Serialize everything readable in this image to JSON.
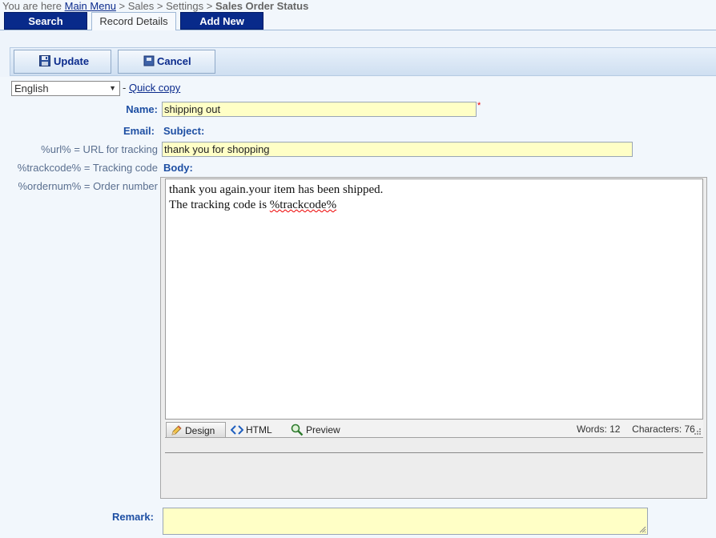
{
  "breadcrumb": {
    "prefix": "You are here",
    "main_menu": "Main Menu",
    "sep": ">",
    "sales": "Sales",
    "settings": "Settings",
    "current": "Sales Order Status"
  },
  "tabs": [
    "Search",
    "Record Details",
    "Add New"
  ],
  "toolbar": {
    "update_label": "Update",
    "cancel_label": "Cancel"
  },
  "language": {
    "selected": "English",
    "separator": "-",
    "quick_copy": "Quick copy"
  },
  "form": {
    "name_label": "Name:",
    "name_value": "shipping out",
    "required_mark": "*",
    "email_label": "Email:",
    "subject_label": "Subject:",
    "subject_value": "thank you for shopping",
    "body_label": "Body:",
    "placeholders": [
      "%url% = URL for tracking",
      "%trackcode% = Tracking code",
      "%ordernum% = Order number"
    ],
    "remark_label": "Remark:",
    "remark_value": ""
  },
  "editor": {
    "line1": "thank you again.your item has been shipped.",
    "line2_prefix": "The tracking code is ",
    "line2_code": "%trackcode%",
    "mode_design": "Design",
    "mode_html": "HTML",
    "mode_preview": "Preview",
    "words": "Words: 12",
    "characters": "Characters: 76"
  }
}
